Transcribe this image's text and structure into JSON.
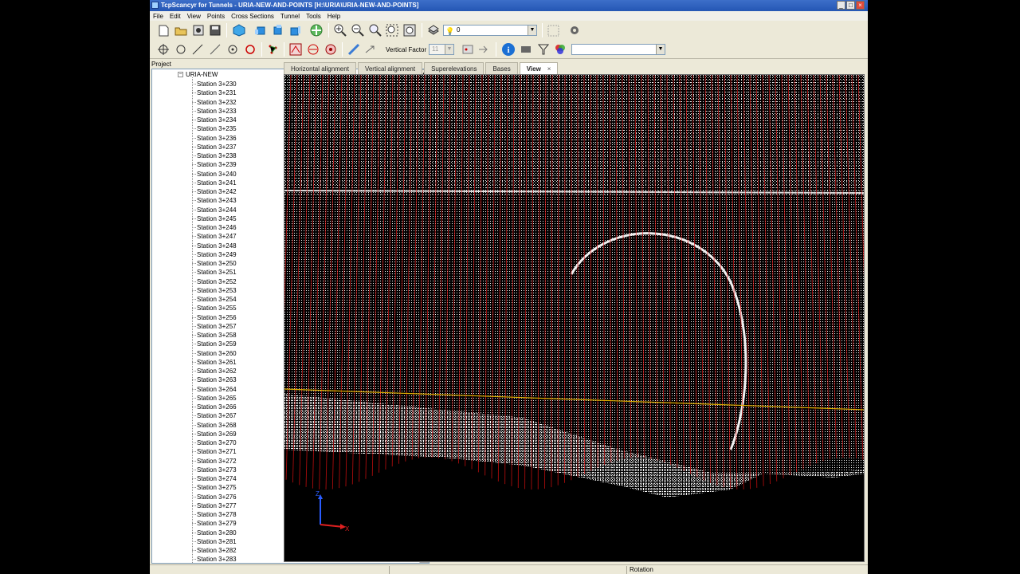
{
  "window": {
    "title": "TcpScancyr for Tunnels - URIA-NEW-AND-POINTS [H:\\URIA\\URIA-NEW-AND-POINTS]",
    "controls": {
      "minimize": "_",
      "maximize": "□",
      "close": "×"
    }
  },
  "menu": [
    "File",
    "Edit",
    "View",
    "Points",
    "Cross Sections",
    "Tunnel",
    "Tools",
    "Help"
  ],
  "toolbar": {
    "layer_combo_value": "0",
    "vertical_factor_label": "Vertical Factor",
    "vertical_factor_value": "11",
    "filter_combo_value": ""
  },
  "project": {
    "label": "Project",
    "root": "URIA-NEW",
    "stations": [
      "Station 3+230",
      "Station 3+231",
      "Station 3+232",
      "Station 3+233",
      "Station 3+234",
      "Station 3+235",
      "Station 3+236",
      "Station 3+237",
      "Station 3+238",
      "Station 3+239",
      "Station 3+240",
      "Station 3+241",
      "Station 3+242",
      "Station 3+243",
      "Station 3+244",
      "Station 3+245",
      "Station 3+246",
      "Station 3+247",
      "Station 3+248",
      "Station 3+249",
      "Station 3+250",
      "Station 3+251",
      "Station 3+252",
      "Station 3+253",
      "Station 3+254",
      "Station 3+255",
      "Station 3+256",
      "Station 3+257",
      "Station 3+258",
      "Station 3+259",
      "Station 3+260",
      "Station 3+261",
      "Station 3+262",
      "Station 3+263",
      "Station 3+264",
      "Station 3+265",
      "Station 3+266",
      "Station 3+267",
      "Station 3+268",
      "Station 3+269",
      "Station 3+270",
      "Station 3+271",
      "Station 3+272",
      "Station 3+273",
      "Station 3+274",
      "Station 3+275",
      "Station 3+276",
      "Station 3+277",
      "Station 3+278",
      "Station 3+279",
      "Station 3+280",
      "Station 3+281",
      "Station 3+282",
      "Station 3+283"
    ]
  },
  "tabs": [
    "Horizontal alignment",
    "Vertical alignment",
    "Superelevations",
    "Bases",
    "View"
  ],
  "active_tab": "View",
  "tab_close": "×",
  "viewport": {
    "axis_z_label": "Z",
    "axis_x_label": "X",
    "colors": {
      "points": "#ffffff",
      "sections": "#e01010",
      "alignment": "#e0b000",
      "background": "#000000"
    }
  },
  "status": {
    "mode": "Rotation"
  }
}
